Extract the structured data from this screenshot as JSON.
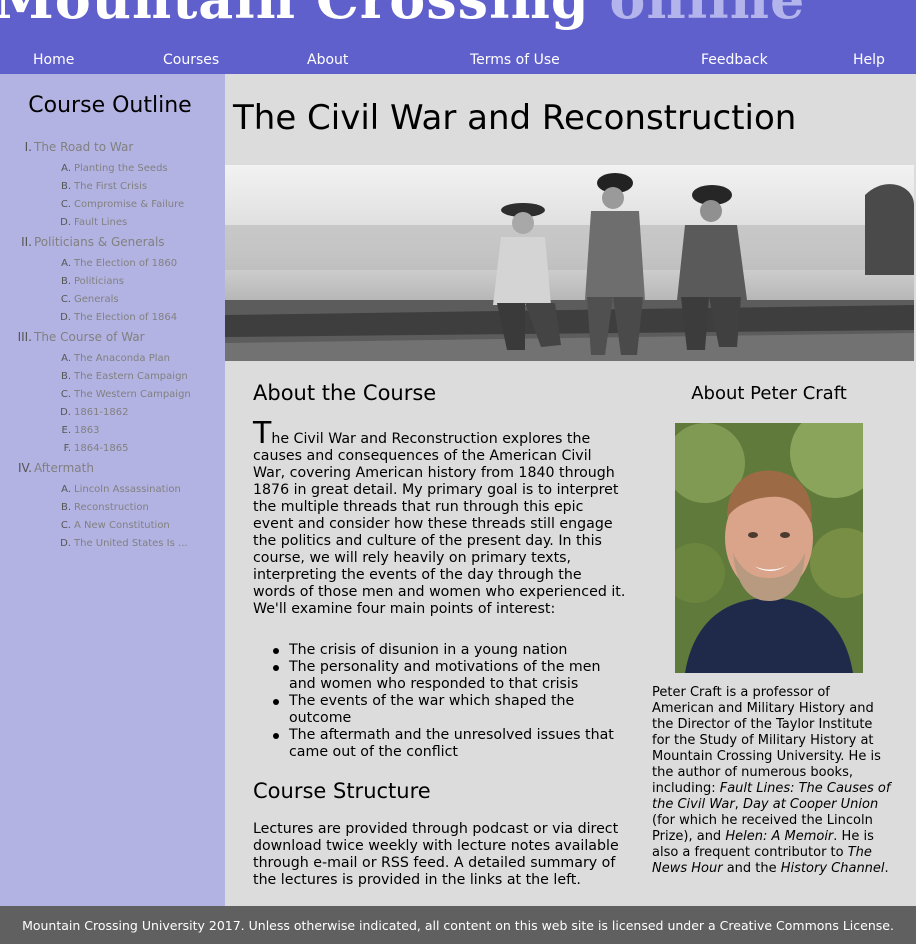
{
  "header": {
    "logo_main": "Mountain Crossing",
    "logo_accent": "online",
    "nav": [
      "Home",
      "Courses",
      "About",
      "Terms of Use",
      "Feedback",
      "Help"
    ]
  },
  "sidebar": {
    "title": "Course Outline",
    "sections": [
      {
        "num": "I.",
        "label": "The Road to War",
        "items": [
          {
            "num": "A.",
            "label": "Planting the Seeds"
          },
          {
            "num": "B.",
            "label": "The First Crisis"
          },
          {
            "num": "C.",
            "label": "Compromise & Failure"
          },
          {
            "num": "D.",
            "label": "Fault Lines"
          }
        ]
      },
      {
        "num": "II.",
        "label": "Politicians & Generals",
        "items": [
          {
            "num": "A.",
            "label": "The Election of 1860"
          },
          {
            "num": "B.",
            "label": "Politicians"
          },
          {
            "num": "C.",
            "label": "Generals"
          },
          {
            "num": "D.",
            "label": "The Election of 1864"
          }
        ]
      },
      {
        "num": "III.",
        "label": "The Course of War",
        "items": [
          {
            "num": "A.",
            "label": "The Anaconda Plan"
          },
          {
            "num": "B.",
            "label": "The Eastern Campaign"
          },
          {
            "num": "C.",
            "label": "The Western Campaign"
          },
          {
            "num": "D.",
            "label": "1861-1862"
          },
          {
            "num": "E.",
            "label": "1863"
          },
          {
            "num": "F.",
            "label": "1864-1865"
          }
        ]
      },
      {
        "num": "IV.",
        "label": "Aftermath",
        "items": [
          {
            "num": "A.",
            "label": "Lincoln Assassination"
          },
          {
            "num": "B.",
            "label": "Reconstruction"
          },
          {
            "num": "C.",
            "label": "A New Constitution"
          },
          {
            "num": "D.",
            "label": "The United States Is ..."
          }
        ]
      }
    ]
  },
  "main": {
    "title": "The Civil War and Reconstruction",
    "about_heading": "About the Course",
    "intro_first_letter": "T",
    "intro_rest": "he Civil War and Reconstruction explores the causes and consequences of the American Civil War, covering American history from 1840 through 1876 in great detail. My primary goal is to interpret the multiple threads that run through this epic event and consider how these threads still engage the politics and culture of the present day. In this course, we will rely heavily on primary texts, interpreting the events of the day through the words of those men and women who experienced it. We'll examine four main points of interest:",
    "points": [
      "The crisis of disunion in a young nation",
      "The personality and motivations of the men and women who responded to that crisis",
      "The events of the war which shaped the outcome",
      "The aftermath and the unresolved issues that came out of the conflict"
    ],
    "structure_heading": "Course Structure",
    "structure_text": "Lectures are provided through podcast or via direct download twice weekly with lecture notes available through e-mail or RSS feed. A detailed summary of the lectures is provided in the links at the left."
  },
  "aside": {
    "heading": "About Peter Craft",
    "bio_1": "Peter Craft is a professor of American and Military History and the Director of the Taylor Institute for the Study of Military History at Mountain Crossing University. He is the author of numerous books, including: ",
    "book_1": "Fault Lines: The Causes of the Civil War",
    "sep_1": ", ",
    "book_2": "Day at Cooper Union",
    "bio_2": " (for which he received the Lincoln Prize), and ",
    "book_3": "Helen: A Memoir",
    "bio_3": ". He is also a frequent contributor to ",
    "pub_1": "The News Hour",
    "bio_4": " and the ",
    "pub_2": "History Channel",
    "bio_5": "."
  },
  "footer": {
    "text": "Mountain Crossing University 2017. Unless otherwise indicated, all content on this web site is licensed under a Creative Commons License."
  },
  "colors": {
    "header_bg": "#6060cc",
    "sidebar_bg": "#b3b3e3",
    "content_bg": "#dcdcdc",
    "footer_bg": "#606060",
    "link_gray": "#808080"
  }
}
